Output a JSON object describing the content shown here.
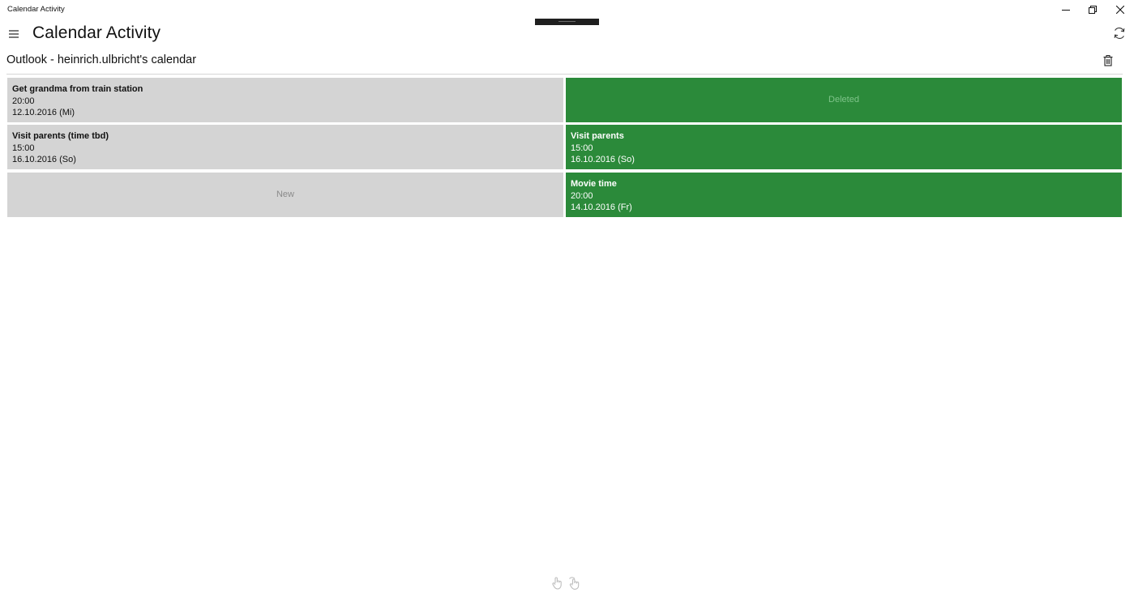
{
  "window": {
    "title": "Calendar Activity"
  },
  "header": {
    "app_title": "Calendar Activity",
    "menu_icon": "hamburger-icon",
    "sync_icon": "sync-icon"
  },
  "calendar": {
    "title": "Outlook - heinrich.ulbricht's calendar",
    "delete_icon": "trash-icon"
  },
  "rows": [
    {
      "left": {
        "kind": "event",
        "title": "Get grandma from train station",
        "time": "20:00",
        "date": "12.10.2016 (Mi)"
      },
      "right": {
        "kind": "placeholder",
        "label": "Deleted"
      }
    },
    {
      "left": {
        "kind": "event",
        "title": "Visit parents (time tbd)",
        "time": "15:00",
        "date": "16.10.2016 (So)"
      },
      "right": {
        "kind": "event",
        "title": "Visit parents",
        "time": "15:00",
        "date": "16.10.2016 (So)"
      }
    },
    {
      "left": {
        "kind": "placeholder",
        "label": "New"
      },
      "right": {
        "kind": "event",
        "title": "Movie time",
        "time": "20:00",
        "date": "14.10.2016 (Fr)"
      }
    }
  ],
  "colors": {
    "original_tile": "#d4d4d4",
    "synced_tile": "#2b8a3a"
  },
  "footer": {
    "icons": [
      "hand-pointer-icon",
      "hand-touch-icon"
    ]
  }
}
